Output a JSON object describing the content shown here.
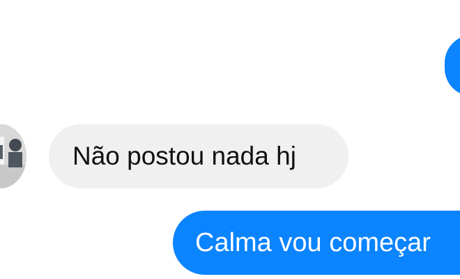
{
  "chat": {
    "messages": [
      {
        "direction": "outgoing",
        "text": "",
        "color": "#0a84ff"
      },
      {
        "direction": "incoming",
        "text": "Não postou nada hj",
        "color": "#f0f0f0"
      },
      {
        "direction": "outgoing",
        "text": "Calma vou começar",
        "color": "#0a84ff"
      }
    ]
  },
  "colors": {
    "background": "#ffffff",
    "outgoing_bubble": "#0a84ff",
    "incoming_bubble": "#f0f0f0",
    "incoming_text": "#111111",
    "outgoing_text": "#ffffff"
  },
  "icons": {
    "avatar": "contact-avatar-photo"
  }
}
